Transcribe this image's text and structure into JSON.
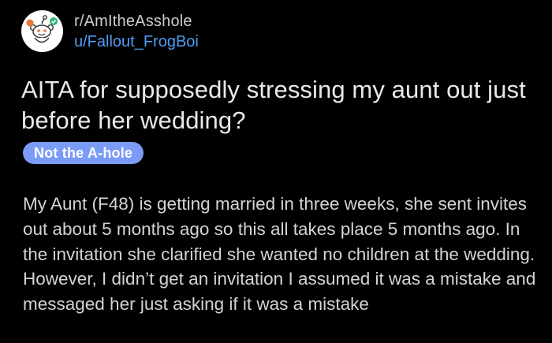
{
  "post": {
    "subreddit": "r/AmItheAsshole",
    "username": "u/Fallout_FrogBoi",
    "title": "AITA for supposedly stressing my aunt out just before her wedding?",
    "flair": "Not the A-hole",
    "body": "My Aunt (F48) is getting married in three weeks, she sent invites out about 5 months ago so this all takes place 5 months ago. In the invitation she clarified she wanted no children at the wedding. However, I didn’t get an invitation I assumed it was a mistake and messaged her just asking if it was a mistake"
  },
  "icons": {
    "avatar": "reddit-snoo-avatar-icon"
  },
  "colors": {
    "background": "#000000",
    "username": "#4f9bf0",
    "flair_bg": "#7a9bf6",
    "badge_green": "#2bb673",
    "badge_orange": "#e9773a"
  }
}
